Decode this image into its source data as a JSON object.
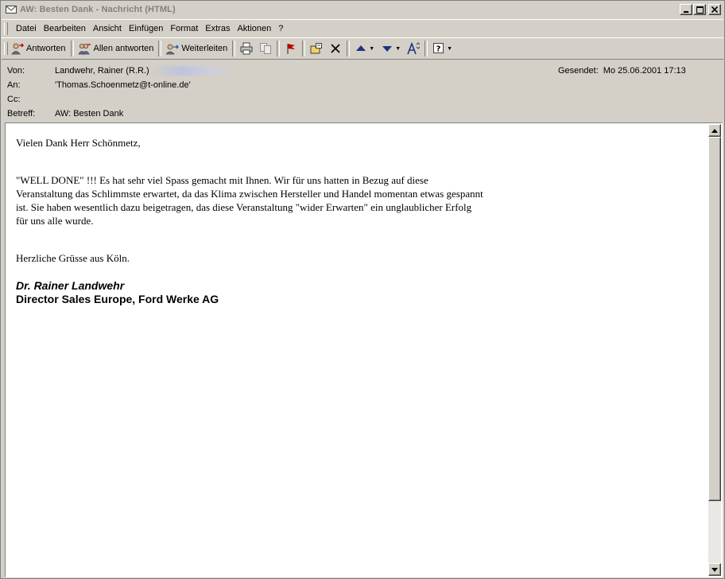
{
  "window": {
    "title": "AW: Besten Dank - Nachricht (HTML)"
  },
  "menu": {
    "items": [
      "Datei",
      "Bearbeiten",
      "Ansicht",
      "Einfügen",
      "Format",
      "Extras",
      "Aktionen",
      "?"
    ]
  },
  "toolbar": {
    "reply_label": "Antworten",
    "reply_all_label": "Allen antworten",
    "forward_label": "Weiterleiten"
  },
  "headers": {
    "from_label": "Von:",
    "from_value": "Landwehr, Rainer (R.R.)",
    "to_label": "An:",
    "to_value": "'Thomas.Schoenmetz@t-online.de'",
    "cc_label": "Cc:",
    "cc_value": "",
    "subject_label": "Betreff:",
    "subject_value": "AW: Besten Dank",
    "sent_label": "Gesendet:",
    "sent_value": "Mo 25.06.2001 17:13"
  },
  "message": {
    "greeting": "Vielen Dank Herr Schönmetz,",
    "paragraph_lines": [
      "\"WELL DONE\" !!! Es hat sehr viel Spass gemacht mit Ihnen. Wir für uns hatten in Bezug auf diese",
      "Veranstaltung das Schlimmste erwartet, da das Klima zwischen Hersteller und Handel momentan etwas gespannt",
      "ist. Sie haben wesentlich dazu beigetragen, das diese Veranstaltung \"wider Erwarten\" ein unglaublicher Erfolg",
      "für uns alle wurde."
    ],
    "closing": "Herzliche Grüsse aus Köln.",
    "signature_name": "Dr. Rainer Landwehr",
    "signature_title": "Director Sales Europe, Ford Werke AG"
  },
  "colors": {
    "chrome": "#d4d0c8",
    "title_text_inactive": "#808080"
  }
}
